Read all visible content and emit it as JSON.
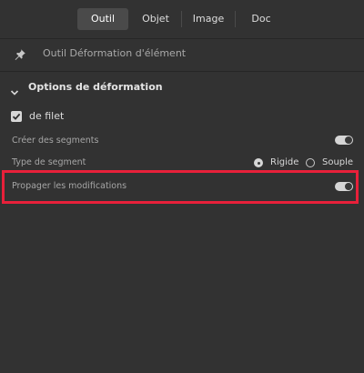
{
  "tabs": [
    {
      "label": "Outil",
      "active": true
    },
    {
      "label": "Objet",
      "active": false
    },
    {
      "label": "Image",
      "active": false
    },
    {
      "label": "Doc",
      "active": false
    }
  ],
  "tool": {
    "icon": "pin-icon",
    "name": "Outil Déformation d'élément"
  },
  "section": {
    "title": "Options de déformation",
    "expanded": true
  },
  "mesh_checkbox": {
    "label": "de filet",
    "checked": true
  },
  "create_segments": {
    "label": "Créer des segments",
    "on": true
  },
  "segment_type": {
    "label": "Type de segment",
    "options": [
      {
        "label": "Rigide",
        "selected": true
      },
      {
        "label": "Souple",
        "selected": false
      }
    ]
  },
  "propagate": {
    "label": "Propager les modifications",
    "on": true
  },
  "colors": {
    "background": "#323232",
    "highlight": "#e8203a",
    "active_tab": "#4a4a4a"
  }
}
